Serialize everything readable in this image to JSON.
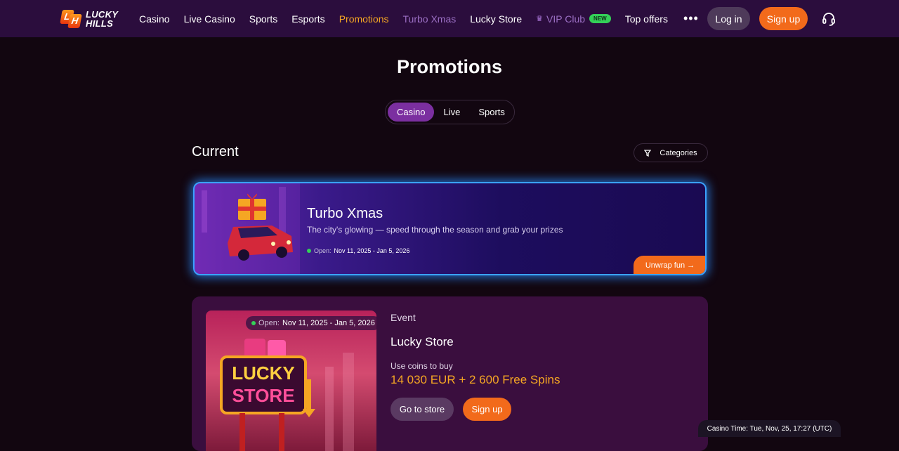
{
  "brand": {
    "line1": "LUCKY",
    "line2": "HILLS",
    "badge1": "L",
    "badge2": "H"
  },
  "nav": {
    "links": [
      "Casino",
      "Live Casino",
      "Sports",
      "Esports",
      "Promotions",
      "Turbo Xmas",
      "Lucky Store",
      "VIP Club",
      "Top offers"
    ],
    "new_badge": "NEW",
    "more": "•••",
    "login": "Log in",
    "signup": "Sign up",
    "active_link": "Promotions"
  },
  "page": {
    "title": "Promotions",
    "tabs": [
      "Casino",
      "Live",
      "Sports"
    ],
    "active_tab": "Casino",
    "section_title": "Current",
    "categories_label": "Categories"
  },
  "turbo": {
    "title": "Turbo Xmas",
    "subtitle": "The city's glowing — speed through the season and grab your prizes",
    "open_label": "Open:",
    "dates": "Nov 11, 2025 - Jan 5, 2026",
    "cta": "Unwrap fun →"
  },
  "store": {
    "open_label": "Open:",
    "dates": "Nov 11, 2025 - Jan 5, 2026",
    "sign_line1": "LUCKY",
    "sign_line2": "STORE",
    "event_label": "Event",
    "title": "Lucky Store",
    "coins_label": "Use coins to buy",
    "coins_value": "14 030 EUR + 2 600 Free Spins",
    "go_store": "Go to store",
    "signup": "Sign up"
  },
  "footer": {
    "casino_time": "Casino Time: Tue, Nov, 25, 17:27 (UTC)"
  },
  "colors": {
    "accent_orange": "#f26a1b",
    "active_gold": "#f5a623",
    "nav_bg": "#2b0d3d",
    "tab_active": "#7b2fa0",
    "glow_blue": "#3aa2ff",
    "open_green": "#34d058"
  }
}
